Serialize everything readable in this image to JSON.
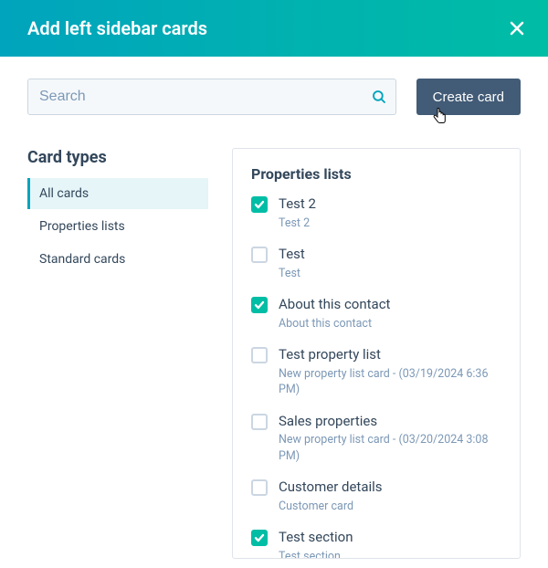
{
  "header": {
    "title": "Add left sidebar cards"
  },
  "search": {
    "placeholder": "Search"
  },
  "create_button": {
    "label": "Create card"
  },
  "sidebar": {
    "heading": "Card types",
    "items": [
      {
        "label": "All cards",
        "active": true
      },
      {
        "label": "Properties lists",
        "active": false
      },
      {
        "label": "Standard cards",
        "active": false
      }
    ]
  },
  "main": {
    "section_heading": "Properties lists",
    "cards": [
      {
        "title": "Test 2",
        "subtitle": "Test 2",
        "checked": true
      },
      {
        "title": "Test",
        "subtitle": "Test",
        "checked": false
      },
      {
        "title": "About this contact",
        "subtitle": "About this contact",
        "checked": true
      },
      {
        "title": "Test property list",
        "subtitle": "New property list card - (03/19/2024 6:36 PM)",
        "checked": false
      },
      {
        "title": "Sales properties",
        "subtitle": "New property list card - (03/20/2024 3:08 PM)",
        "checked": false
      },
      {
        "title": "Customer details",
        "subtitle": "Customer card",
        "checked": false
      },
      {
        "title": "Test section",
        "subtitle": "Test section",
        "checked": true
      }
    ]
  }
}
